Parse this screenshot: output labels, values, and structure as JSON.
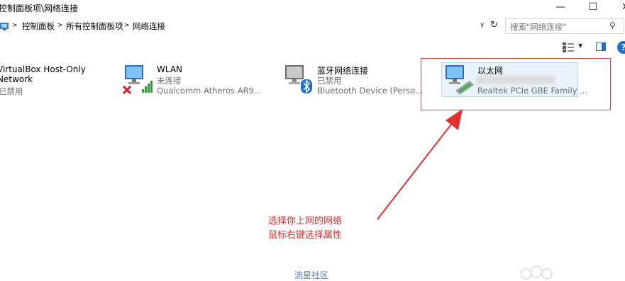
{
  "window": {
    "title": "控制面板项\\网络连接",
    "controls": {
      "minimize": "—",
      "maximize": "☐",
      "close": "✕"
    }
  },
  "address_bar": {
    "breadcrumbs": [
      "控制面板",
      "所有控制面板项",
      "网络连接"
    ],
    "separator": ">",
    "search_placeholder": "搜索\"网络连接\""
  },
  "connections": [
    {
      "name": "VirtualBox Host-Only",
      "name2": "Network",
      "status": "已禁用",
      "device": ""
    },
    {
      "name": "WLAN",
      "status": "未连接",
      "device": "Qualcomm Atheros AR9..."
    },
    {
      "name": "蓝牙网络连接",
      "status": "已禁用",
      "device": "Bluetooth Device (Perso..."
    },
    {
      "name": "以太网",
      "status": "",
      "device": "Realtek PCIe GBE Family ..."
    }
  ],
  "annotation": {
    "line1": "选择你上网的网络",
    "line2": "鼠标右键选择属性"
  },
  "watermark": "流星社区",
  "colors": {
    "annotation": "#e0302f",
    "selection_fill": "#e8f2fb",
    "selection_border": "#bcd8f1",
    "help": "#1e6fd0"
  }
}
